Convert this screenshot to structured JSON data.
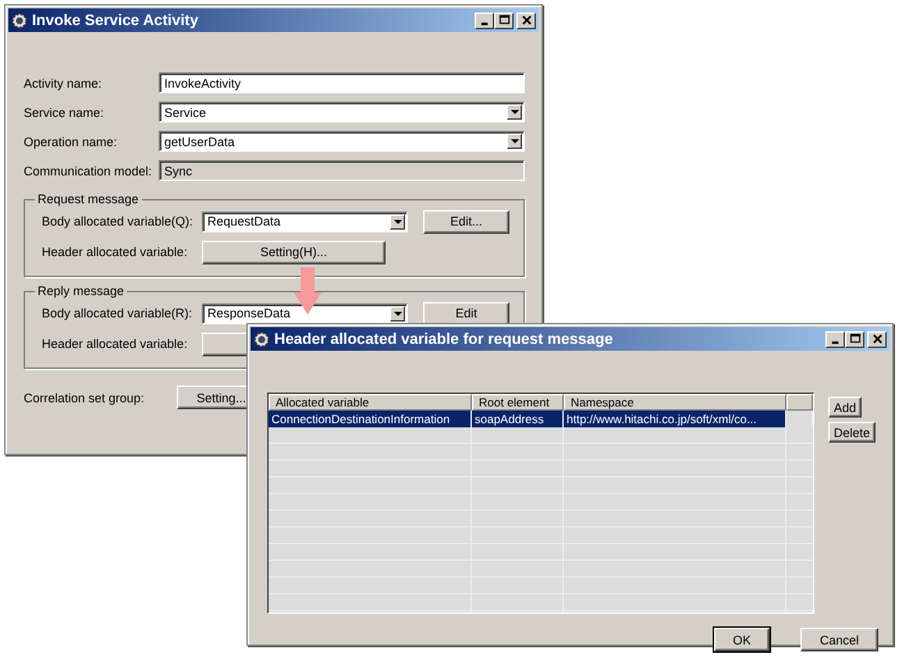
{
  "main_window": {
    "title": "Invoke Service Activity",
    "fields": [
      {
        "kind": "text",
        "label": "Activity name:",
        "value": "InvokeActivity"
      },
      {
        "kind": "combo",
        "label": "Service name:",
        "value": "Service"
      },
      {
        "kind": "combo",
        "label": "Operation name:",
        "value": "getUserData"
      },
      {
        "kind": "readonly",
        "label": "Communication model:",
        "value": "Sync"
      }
    ],
    "request_message": {
      "title": "Request message",
      "body_label": "Body allocated variable(Q):",
      "body_value": "RequestData",
      "edit_button": "Edit...",
      "header_label": "Header allocated variable:",
      "header_button": "Setting(H)..."
    },
    "reply_message": {
      "title": "Reply message",
      "body_label": "Body allocated variable(R):",
      "body_value": "ResponseData",
      "edit_button": "Edit",
      "header_label": "Header allocated variable:"
    },
    "correlation": {
      "label": "Correlation set group:",
      "button": "Setting..."
    }
  },
  "dialog": {
    "title": "Header allocated variable for request message",
    "table": {
      "columns": [
        "Allocated variable",
        "Root element",
        "Namespace"
      ],
      "rows": [
        {
          "cells": [
            "ConnectionDestinationInformation",
            "soapAddress",
            "http://www.hitachi.co.jp/soft/xml/co..."
          ],
          "selected": true
        }
      ]
    },
    "side_buttons": [
      "Add",
      "Delete"
    ],
    "buttons": [
      "OK",
      "Cancel"
    ]
  }
}
